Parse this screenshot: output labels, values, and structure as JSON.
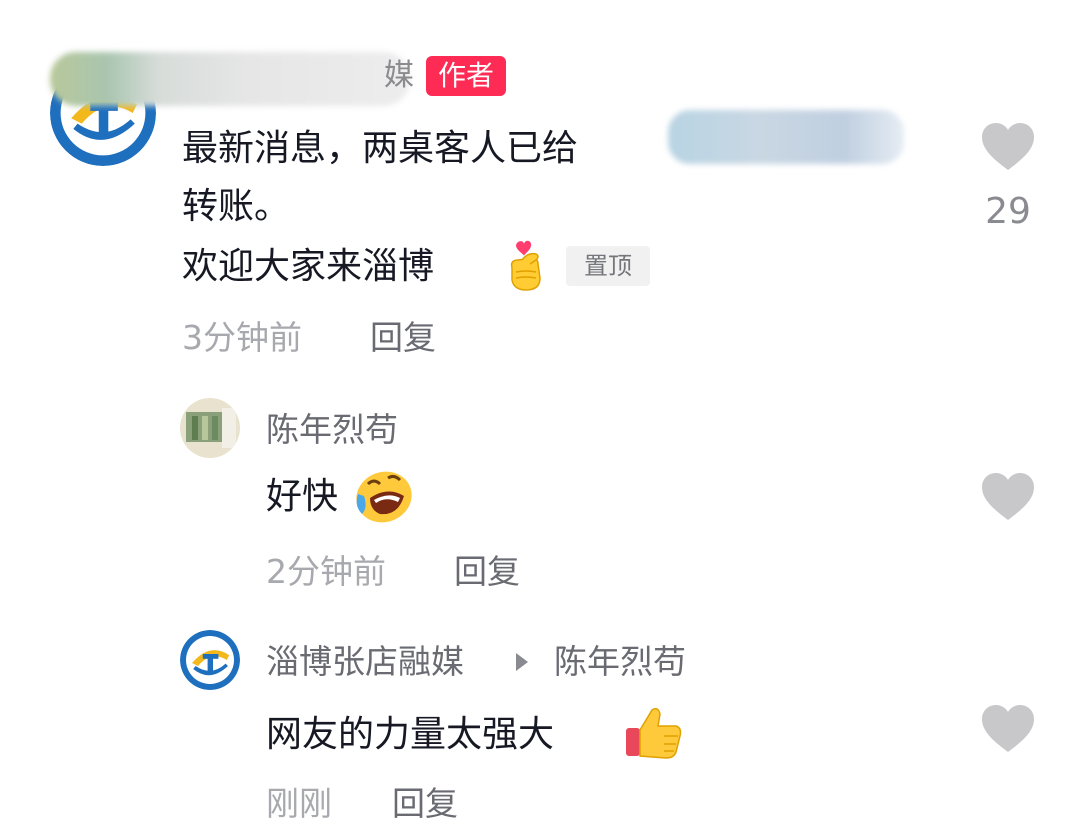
{
  "comments": [
    {
      "author_visible_fragment": "媒",
      "author_badge": "作者",
      "text_line1": "最新消息，两桌客人已给",
      "text_line2": "转账。",
      "text_line3": "欢迎大家来淄博",
      "text_emoji": "finger-heart",
      "pinned_label": "置顶",
      "time": "3分钟前",
      "reply_label": "回复",
      "likes": "29"
    }
  ],
  "replies": [
    {
      "author": "陈年烈苟",
      "text": "好快",
      "text_emoji": "rolling-on-floor-laughing",
      "time": "2分钟前",
      "reply_label": "回复"
    },
    {
      "author": "淄博张店融媒",
      "reply_to": "陈年烈苟",
      "text": "网友的力量太强大",
      "text_emoji": "thumbs-up",
      "time": "刚刚",
      "reply_label": "回复"
    }
  ],
  "colors": {
    "author_badge_bg": "#fe2c55",
    "heart_gray": "#c8c8cb",
    "logo_blue": "#1f6fbf",
    "logo_yellow": "#f3b81c"
  }
}
